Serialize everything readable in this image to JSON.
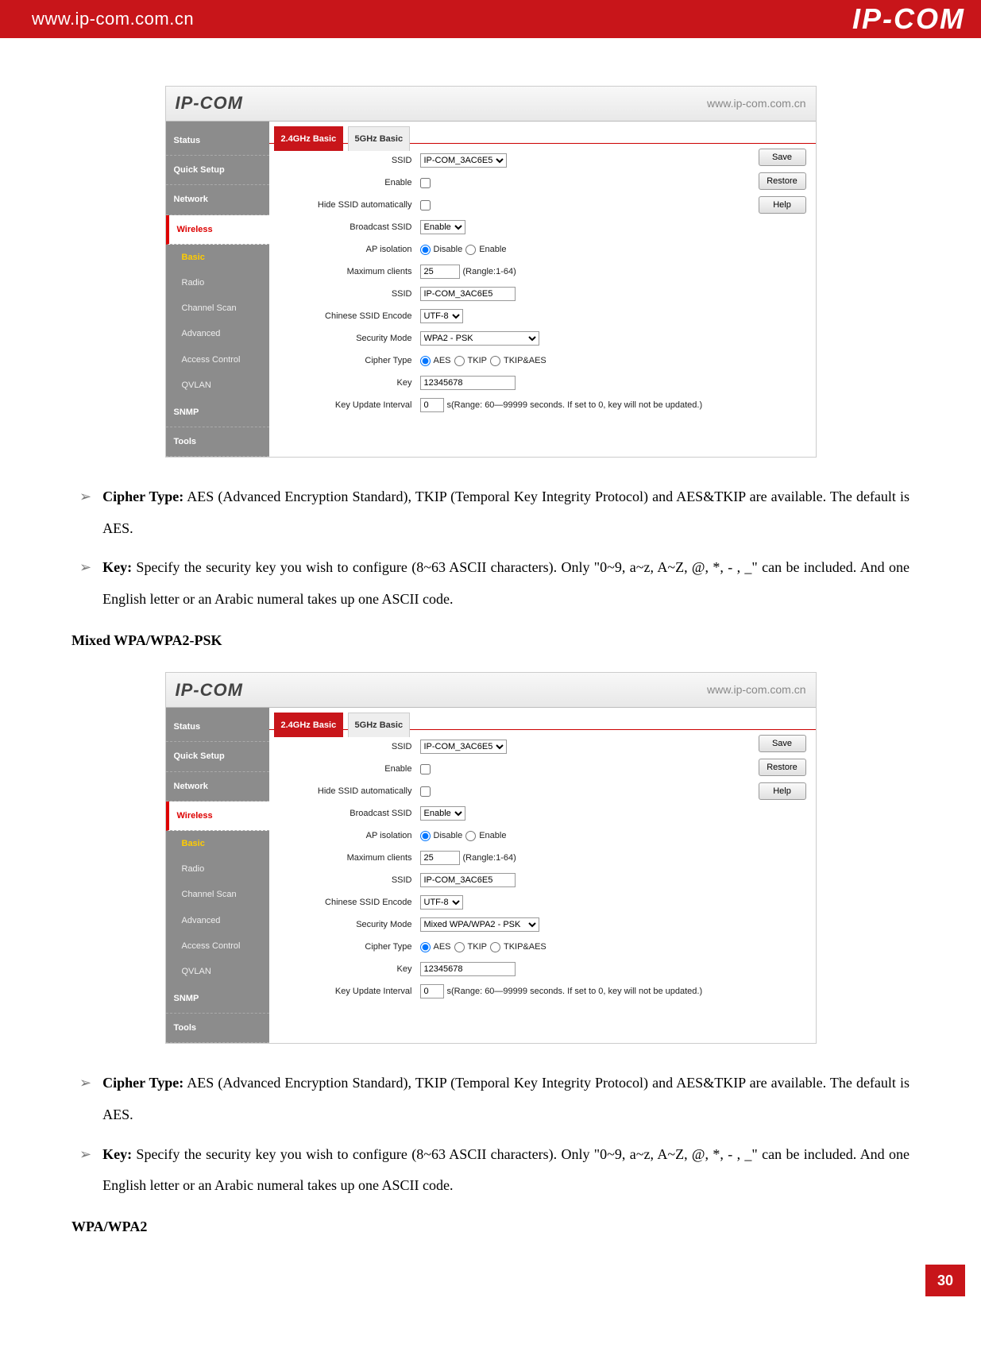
{
  "header": {
    "url": "www.ip-com.com.cn",
    "logo": "IP-COM"
  },
  "pageNumber": "30",
  "router": {
    "logo": "IP-COM",
    "url": "www.ip-com.com.cn",
    "nav": {
      "status": "Status",
      "quickSetup": "Quick Setup",
      "network": "Network",
      "wireless": "Wireless",
      "basic": "Basic",
      "radio": "Radio",
      "channelScan": "Channel Scan",
      "advanced": "Advanced",
      "accessControl": "Access Control",
      "qvlan": "QVLAN",
      "snmp": "SNMP",
      "tools": "Tools"
    },
    "tabs": {
      "t24": "2.4GHz Basic",
      "t5": "5GHz Basic"
    },
    "buttons": {
      "save": "Save",
      "restore": "Restore",
      "help": "Help"
    },
    "fields": {
      "ssidLabel": "SSID",
      "ssidSelect": "IP-COM_3AC6E5",
      "enableLabel": "Enable",
      "hideLabel": "Hide SSID automatically",
      "broadcastLabel": "Broadcast SSID",
      "broadcastVal": "Enable",
      "apIsoLabel": "AP isolation",
      "apDisable": "Disable",
      "apEnable": "Enable",
      "maxClientsLabel": "Maximum clients",
      "maxClientsVal": "25",
      "maxClientsHint": "(Rangle:1-64)",
      "ssid2Label": "SSID",
      "ssid2Val": "IP-COM_3AC6E5",
      "encodeLabel": "Chinese SSID Encode",
      "encodeVal": "UTF-8",
      "securityLabel": "Security Mode",
      "cipherLabel": "Cipher Type",
      "cipherAES": "AES",
      "cipherTKIP": "TKIP",
      "cipherBoth": "TKIP&AES",
      "keyLabel": "Key",
      "keyVal": "12345678",
      "intervalLabel": "Key Update Interval",
      "intervalVal": "0",
      "intervalHint": "s(Range: 60—99999 seconds. If set to 0, key will not be updated.)"
    }
  },
  "screenshots": [
    {
      "securityMode": "WPA2 - PSK"
    },
    {
      "securityMode": "Mixed WPA/WPA2 - PSK"
    }
  ],
  "doc": {
    "cipherTypeLead": "Cipher Type:",
    "cipherTypeBody": " AES (Advanced Encryption Standard), TKIP (Temporal Key Integrity Protocol) and AES&TKIP are available. The default is AES.",
    "keyLead": "Key:",
    "keyBody": " Specify the security key you wish to configure (8~63 ASCII characters). Only \"0~9, a~z, A~Z, @, *, - , _\" can be included. And one English letter or an Arabic numeral takes up one ASCII code.",
    "heading1": "Mixed WPA/WPA2-PSK",
    "heading2": "WPA/WPA2"
  }
}
